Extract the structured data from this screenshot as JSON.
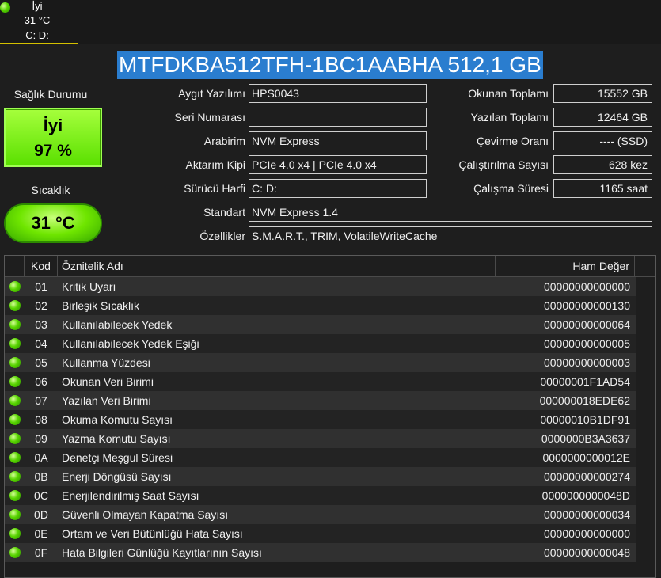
{
  "disk_tab": {
    "status": "İyi",
    "temperature": "31 °C",
    "drives": "C: D:"
  },
  "model": "MTFDKBA512TFH-1BC1AABHA 512,1 GB",
  "health": {
    "label": "Sağlık Durumu",
    "status": "İyi",
    "percent": "97 %"
  },
  "temperature": {
    "label": "Sıcaklık",
    "value": "31 °C"
  },
  "fields": {
    "firmware": {
      "label": "Aygıt Yazılımı",
      "value": "HPS0043"
    },
    "serial": {
      "label": "Seri Numarası",
      "value": ""
    },
    "interface": {
      "label": "Arabirim",
      "value": "NVM Express"
    },
    "transfer": {
      "label": "Aktarım Kipi",
      "value": "PCIe 4.0 x4 | PCIe 4.0 x4"
    },
    "drive_letter": {
      "label": "Sürücü Harfi",
      "value": "C: D:"
    },
    "standard": {
      "label": "Standart",
      "value": "NVM Express 1.4"
    },
    "features": {
      "label": "Özellikler",
      "value": "S.M.A.R.T., TRIM, VolatileWriteCache"
    },
    "host_reads": {
      "label": "Okunan Toplamı",
      "value": "15552 GB"
    },
    "host_writes": {
      "label": "Yazılan Toplamı",
      "value": "12464 GB"
    },
    "rotation": {
      "label": "Çevirme Oranı",
      "value": "---- (SSD)"
    },
    "power_count": {
      "label": "Çalıştırılma Sayısı",
      "value": "628 kez"
    },
    "power_hours": {
      "label": "Çalışma Süresi",
      "value": "1165 saat"
    }
  },
  "table": {
    "headers": {
      "code": "Kod",
      "name": "Öznitelik Adı",
      "raw": "Ham Değer"
    },
    "rows": [
      {
        "code": "01",
        "name": "Kritik Uyarı",
        "raw": "00000000000000"
      },
      {
        "code": "02",
        "name": "Birleşik Sıcaklık",
        "raw": "00000000000130"
      },
      {
        "code": "03",
        "name": "Kullanılabilecek Yedek",
        "raw": "00000000000064"
      },
      {
        "code": "04",
        "name": "Kullanılabilecek Yedek Eşiği",
        "raw": "00000000000005"
      },
      {
        "code": "05",
        "name": "Kullanma Yüzdesi",
        "raw": "00000000000003"
      },
      {
        "code": "06",
        "name": "Okunan Veri Birimi",
        "raw": "00000001F1AD54"
      },
      {
        "code": "07",
        "name": "Yazılan Veri Birimi",
        "raw": "000000018EDE62"
      },
      {
        "code": "08",
        "name": "Okuma Komutu Sayısı",
        "raw": "00000010B1DF91"
      },
      {
        "code": "09",
        "name": "Yazma Komutu Sayısı",
        "raw": "0000000B3A3637"
      },
      {
        "code": "0A",
        "name": "Denetçi Meşgul Süresi",
        "raw": "0000000000012E"
      },
      {
        "code": "0B",
        "name": "Enerji Döngüsü Sayısı",
        "raw": "00000000000274"
      },
      {
        "code": "0C",
        "name": "Enerjilendirilmiş Saat Sayısı",
        "raw": "0000000000048D"
      },
      {
        "code": "0D",
        "name": "Güvenli Olmayan Kapatma Sayısı",
        "raw": "00000000000034"
      },
      {
        "code": "0E",
        "name": "Ortam ve Veri Bütünlüğü Hata Sayısı",
        "raw": "00000000000000"
      },
      {
        "code": "0F",
        "name": "Hata Bilgileri Günlüğü Kayıtlarının Sayısı",
        "raw": "00000000000048"
      }
    ]
  },
  "colors": {
    "good": "#58d400",
    "model_highlight": "#2a7dcf",
    "background": "#1e1e1e"
  }
}
